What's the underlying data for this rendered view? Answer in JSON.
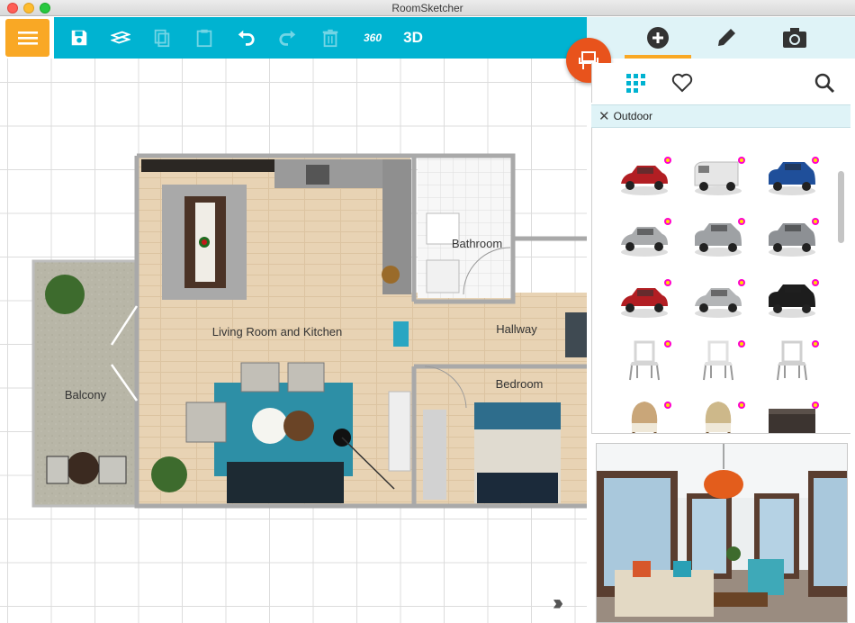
{
  "window": {
    "title": "RoomSketcher"
  },
  "toolbar": {
    "menu_icon": "hamburger-icon",
    "view_360_label": "360",
    "view_3d_label": "3D",
    "accent": "#00b3d1",
    "menu_accent": "#f9a825"
  },
  "rooms": {
    "living": "Living Room and Kitchen",
    "bathroom": "Bathroom",
    "hallway": "Hallway",
    "bedroom": "Bedroom",
    "balcony": "Balcony"
  },
  "panel": {
    "tabs": [
      "add-icon",
      "pencil-icon",
      "camera-icon"
    ],
    "filter_category": "Outdoor",
    "fab_icon": "chair-icon",
    "fab_color": "#e8531c"
  },
  "catalog": {
    "items": [
      {
        "kind": "car",
        "color": "#b21e23"
      },
      {
        "kind": "van",
        "color": "#e6e6e6"
      },
      {
        "kind": "pickup",
        "color": "#1f4f9a"
      },
      {
        "kind": "car",
        "color": "#a9abad"
      },
      {
        "kind": "suv",
        "color": "#9ea1a4"
      },
      {
        "kind": "suv",
        "color": "#8d9094"
      },
      {
        "kind": "car",
        "color": "#b21e23"
      },
      {
        "kind": "sedan",
        "color": "#b3b5b7"
      },
      {
        "kind": "suv",
        "color": "#1d1d1d"
      },
      {
        "kind": "chair",
        "color": "#d5d5d5"
      },
      {
        "kind": "chair",
        "color": "#e0e0e0"
      },
      {
        "kind": "chair",
        "color": "#d0d0d0"
      },
      {
        "kind": "wicker-chair",
        "color": "#c9a679"
      },
      {
        "kind": "wicker-chair",
        "color": "#cdb88a"
      },
      {
        "kind": "ottoman",
        "color": "#3c3430"
      }
    ]
  }
}
